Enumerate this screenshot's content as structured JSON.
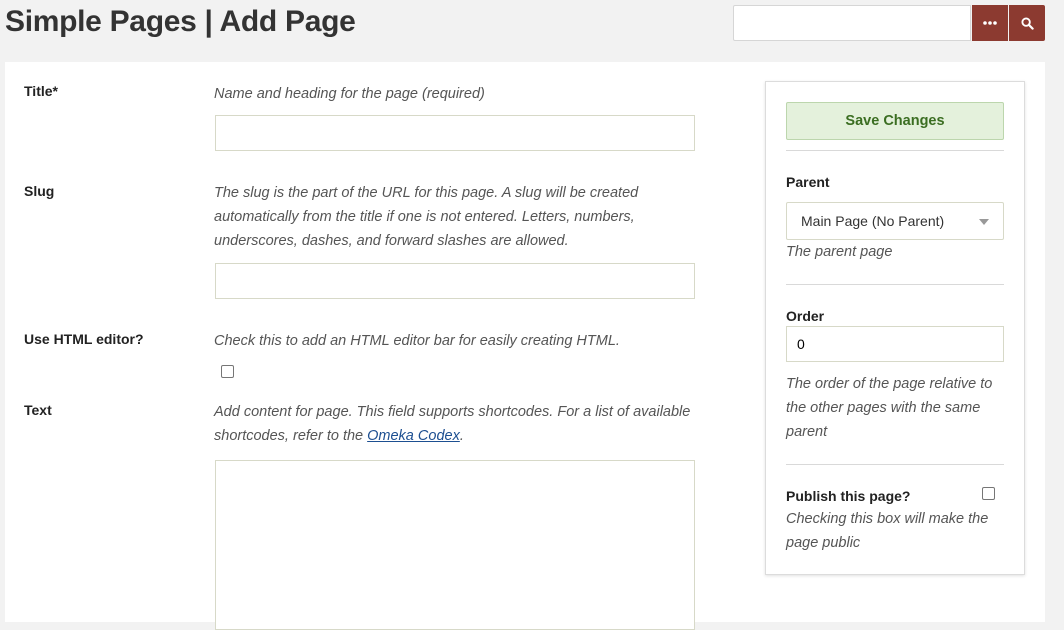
{
  "header": {
    "title": "Simple Pages | Add Page"
  },
  "search": {
    "value": "",
    "placeholder": ""
  },
  "form": {
    "title": {
      "label": "Title*",
      "hint": "Name and heading for the page (required)",
      "value": ""
    },
    "slug": {
      "label": "Slug",
      "hint_lines": [
        "The slug is the part of the URL for this page. A slug will be created",
        "automatically from the title if one is not entered. Letters, numbers,",
        "underscores, dashes, and forward slashes are allowed."
      ],
      "value": ""
    },
    "html_editor": {
      "label": "Use HTML editor?",
      "hint": "Check this to add an HTML editor bar for easily creating HTML.",
      "checked": false
    },
    "text": {
      "label": "Text",
      "hint_line1": "Add content for page. This field supports shortcodes. For a list of available",
      "hint_line2_prefix": "shortcodes, refer to the ",
      "hint_link": "Omeka Codex",
      "hint_line2_suffix": ".",
      "value": ""
    }
  },
  "sidebar": {
    "save_label": "Save Changes",
    "parent": {
      "label": "Parent",
      "selected": "Main Page (No Parent)",
      "hint": "The parent page"
    },
    "order": {
      "label": "Order",
      "value": "0",
      "hint_lines": [
        "The order of the page relative to",
        "the other pages with the same",
        "parent"
      ]
    },
    "publish": {
      "label": "Publish this page?",
      "checked": false,
      "hint_lines": [
        "Checking this box will make the",
        "page public"
      ]
    }
  },
  "colors": {
    "accent": "#8c3a30",
    "save_bg": "#e4f1dc",
    "save_text": "#3b6e22",
    "link": "#1d4f91"
  },
  "icons": {
    "more": "ellipsis-icon",
    "search": "search-icon"
  }
}
